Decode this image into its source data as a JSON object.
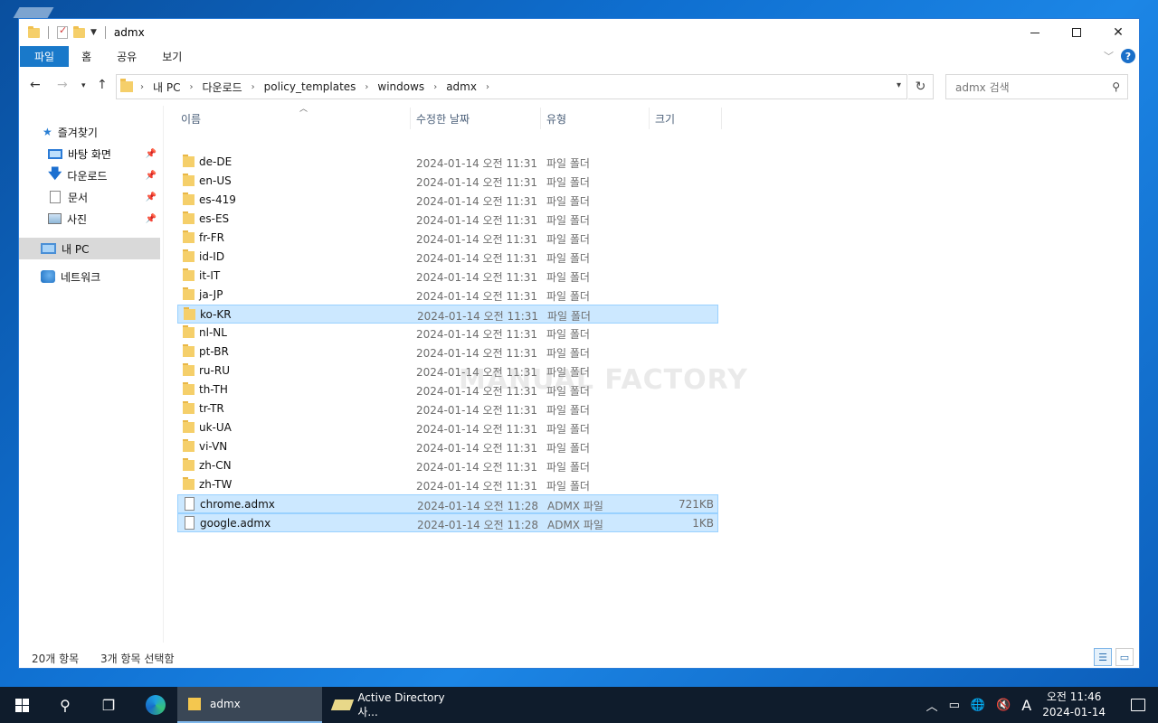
{
  "window": {
    "title": "admx",
    "ribbon_tabs": [
      {
        "label": "파일"
      },
      {
        "label": "홈"
      },
      {
        "label": "공유"
      },
      {
        "label": "보기"
      }
    ]
  },
  "address": {
    "crumbs": [
      "내 PC",
      "다운로드",
      "policy_templates",
      "windows",
      "admx"
    ],
    "search_placeholder": "admx 검색"
  },
  "sidebar": {
    "quick_access": "즐겨찾기",
    "items": [
      {
        "label": "바탕 화면",
        "icon": "desktop-icon",
        "pinned": true
      },
      {
        "label": "다운로드",
        "icon": "download-icon",
        "pinned": true
      },
      {
        "label": "문서",
        "icon": "document-icon",
        "pinned": true
      },
      {
        "label": "사진",
        "icon": "pictures-icon",
        "pinned": true
      }
    ],
    "this_pc": "내 PC",
    "network": "네트워크"
  },
  "columns": {
    "name": "이름",
    "date": "수정한 날짜",
    "type": "유형",
    "size": "크기"
  },
  "files": [
    {
      "name": "de-DE",
      "date": "2024-01-14 오전 11:31",
      "type": "파일 폴더",
      "size": "",
      "kind": "folder",
      "selected": false
    },
    {
      "name": "en-US",
      "date": "2024-01-14 오전 11:31",
      "type": "파일 폴더",
      "size": "",
      "kind": "folder",
      "selected": false
    },
    {
      "name": "es-419",
      "date": "2024-01-14 오전 11:31",
      "type": "파일 폴더",
      "size": "",
      "kind": "folder",
      "selected": false
    },
    {
      "name": "es-ES",
      "date": "2024-01-14 오전 11:31",
      "type": "파일 폴더",
      "size": "",
      "kind": "folder",
      "selected": false
    },
    {
      "name": "fr-FR",
      "date": "2024-01-14 오전 11:31",
      "type": "파일 폴더",
      "size": "",
      "kind": "folder",
      "selected": false
    },
    {
      "name": "id-ID",
      "date": "2024-01-14 오전 11:31",
      "type": "파일 폴더",
      "size": "",
      "kind": "folder",
      "selected": false
    },
    {
      "name": "it-IT",
      "date": "2024-01-14 오전 11:31",
      "type": "파일 폴더",
      "size": "",
      "kind": "folder",
      "selected": false
    },
    {
      "name": "ja-JP",
      "date": "2024-01-14 오전 11:31",
      "type": "파일 폴더",
      "size": "",
      "kind": "folder",
      "selected": false
    },
    {
      "name": "ko-KR",
      "date": "2024-01-14 오전 11:31",
      "type": "파일 폴더",
      "size": "",
      "kind": "folder",
      "selected": true
    },
    {
      "name": "nl-NL",
      "date": "2024-01-14 오전 11:31",
      "type": "파일 폴더",
      "size": "",
      "kind": "folder",
      "selected": false
    },
    {
      "name": "pt-BR",
      "date": "2024-01-14 오전 11:31",
      "type": "파일 폴더",
      "size": "",
      "kind": "folder",
      "selected": false
    },
    {
      "name": "ru-RU",
      "date": "2024-01-14 오전 11:31",
      "type": "파일 폴더",
      "size": "",
      "kind": "folder",
      "selected": false
    },
    {
      "name": "th-TH",
      "date": "2024-01-14 오전 11:31",
      "type": "파일 폴더",
      "size": "",
      "kind": "folder",
      "selected": false
    },
    {
      "name": "tr-TR",
      "date": "2024-01-14 오전 11:31",
      "type": "파일 폴더",
      "size": "",
      "kind": "folder",
      "selected": false
    },
    {
      "name": "uk-UA",
      "date": "2024-01-14 오전 11:31",
      "type": "파일 폴더",
      "size": "",
      "kind": "folder",
      "selected": false
    },
    {
      "name": "vi-VN",
      "date": "2024-01-14 오전 11:31",
      "type": "파일 폴더",
      "size": "",
      "kind": "folder",
      "selected": false
    },
    {
      "name": "zh-CN",
      "date": "2024-01-14 오전 11:31",
      "type": "파일 폴더",
      "size": "",
      "kind": "folder",
      "selected": false
    },
    {
      "name": "zh-TW",
      "date": "2024-01-14 오전 11:31",
      "type": "파일 폴더",
      "size": "",
      "kind": "folder",
      "selected": false
    },
    {
      "name": "chrome.admx",
      "date": "2024-01-14 오전 11:28",
      "type": "ADMX 파일",
      "size": "721KB",
      "kind": "file",
      "selected": true
    },
    {
      "name": "google.admx",
      "date": "2024-01-14 오전 11:28",
      "type": "ADMX 파일",
      "size": "1KB",
      "kind": "file",
      "selected": true
    }
  ],
  "watermark": "MANUAL FACTORY",
  "status": {
    "count": "20개 항목",
    "selected": "3개 항목 선택함"
  },
  "taskbar": {
    "apps": [
      {
        "label": "admx",
        "active": true
      },
      {
        "label": "Active Directory 사...",
        "active": false
      }
    ],
    "ime": "A",
    "clock_time": "오전 11:46",
    "clock_date": "2024-01-14"
  },
  "colors": {
    "accent": "#1979ca",
    "selection": "#cce8ff",
    "folder": "#f5cf6a"
  }
}
